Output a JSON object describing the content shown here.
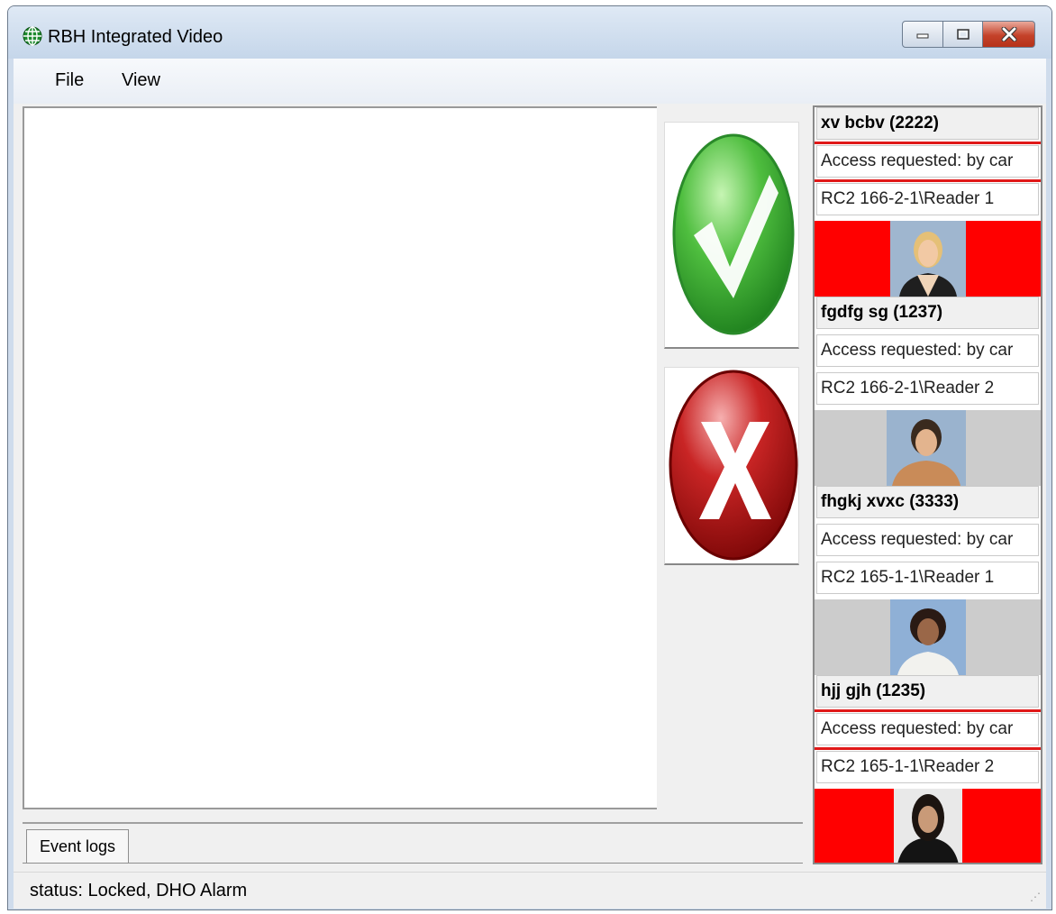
{
  "window": {
    "title": "RBH Integrated Video"
  },
  "menu": [
    "File",
    "View"
  ],
  "tabs": [
    "Event logs"
  ],
  "status": "status: Locked, DHO Alarm",
  "colors": {
    "alarm_red": "#ff0000",
    "neutral_gray": "#cccccc",
    "accept_green": "#3fb03f",
    "reject_red": "#b01414"
  },
  "events": [
    {
      "name": "xv bcbv (2222)",
      "message": "Access requested: by car",
      "reader": "RC2 166-2-1\\Reader 1",
      "alarm": true,
      "photo": "person-photo-blonde-woman"
    },
    {
      "name": "fgdfg sg (1237)",
      "message": "Access requested: by car",
      "reader": "RC2 166-2-1\\Reader 2",
      "alarm": false,
      "photo": "person-photo-dark-hair-woman"
    },
    {
      "name": "fhgkj xvxc (3333)",
      "message": "Access requested: by car",
      "reader": "RC2 165-1-1\\Reader 1",
      "alarm": false,
      "photo": "person-photo-curly-hair-woman"
    },
    {
      "name": "hjj gjh (1235)",
      "message": "Access requested: by car",
      "reader": "RC2 165-1-1\\Reader 2",
      "alarm": true,
      "photo": "person-photo-long-hair-woman"
    }
  ]
}
